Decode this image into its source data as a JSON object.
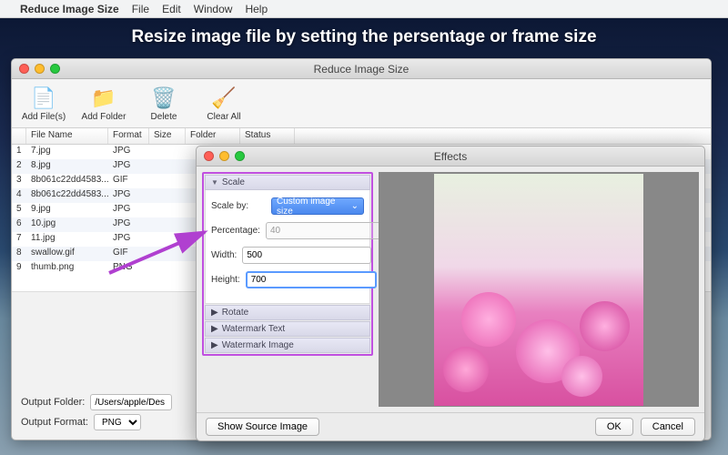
{
  "menubar": {
    "app": "Reduce Image Size",
    "items": [
      "File",
      "Edit",
      "Window",
      "Help"
    ]
  },
  "caption": "Resize image file by setting the persentage or frame size",
  "main": {
    "title": "Reduce Image Size",
    "toolbar": {
      "add_files": "Add File(s)",
      "add_folder": "Add Folder",
      "delete": "Delete",
      "clear_all": "Clear All"
    },
    "columns": {
      "name": "File Name",
      "format": "Format",
      "size": "Size",
      "folder": "Folder",
      "status": "Status"
    },
    "rows": [
      {
        "n": "1",
        "name": "7.jpg",
        "fmt": "JPG"
      },
      {
        "n": "2",
        "name": "8.jpg",
        "fmt": "JPG"
      },
      {
        "n": "3",
        "name": "8b061c22dd4583...",
        "fmt": "GIF"
      },
      {
        "n": "4",
        "name": "8b061c22dd4583...",
        "fmt": "JPG"
      },
      {
        "n": "5",
        "name": "9.jpg",
        "fmt": "JPG"
      },
      {
        "n": "6",
        "name": "10.jpg",
        "fmt": "JPG"
      },
      {
        "n": "7",
        "name": "11.jpg",
        "fmt": "JPG"
      },
      {
        "n": "8",
        "name": "swallow.gif",
        "fmt": "GIF"
      },
      {
        "n": "9",
        "name": "thumb.png",
        "fmt": "PNG"
      }
    ],
    "output_folder_label": "Output Folder:",
    "output_folder_value": "/Users/apple/Des",
    "output_format_label": "Output Format:",
    "output_format_value": "PNG"
  },
  "effects": {
    "title": "Effects",
    "scale": {
      "header": "Scale",
      "scale_by_label": "Scale by:",
      "scale_by_value": "Custom image size",
      "percentage_label": "Percentage:",
      "percentage_value": "40",
      "width_label": "Width:",
      "width_value": "500",
      "height_label": "Height:",
      "height_value": "700"
    },
    "rotate": "Rotate",
    "watermark_text": "Watermark Text",
    "watermark_image": "Watermark Image",
    "show_source": "Show Source Image",
    "ok": "OK",
    "cancel": "Cancel"
  }
}
